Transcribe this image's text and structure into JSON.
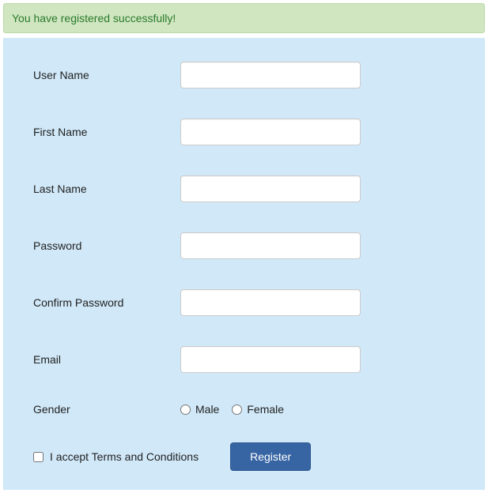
{
  "alert": {
    "message": "You have registered successfully!"
  },
  "form": {
    "fields": {
      "username": {
        "label": "User Name",
        "value": ""
      },
      "firstname": {
        "label": "First Name",
        "value": ""
      },
      "lastname": {
        "label": "Last Name",
        "value": ""
      },
      "password": {
        "label": "Password",
        "value": ""
      },
      "confirm_password": {
        "label": "Confirm Password",
        "value": ""
      },
      "email": {
        "label": "Email",
        "value": ""
      }
    },
    "gender": {
      "label": "Gender",
      "options": {
        "male": "Male",
        "female": "Female"
      }
    },
    "terms": {
      "label": "I accept Terms and Conditions"
    },
    "submit": {
      "label": "Register"
    }
  }
}
